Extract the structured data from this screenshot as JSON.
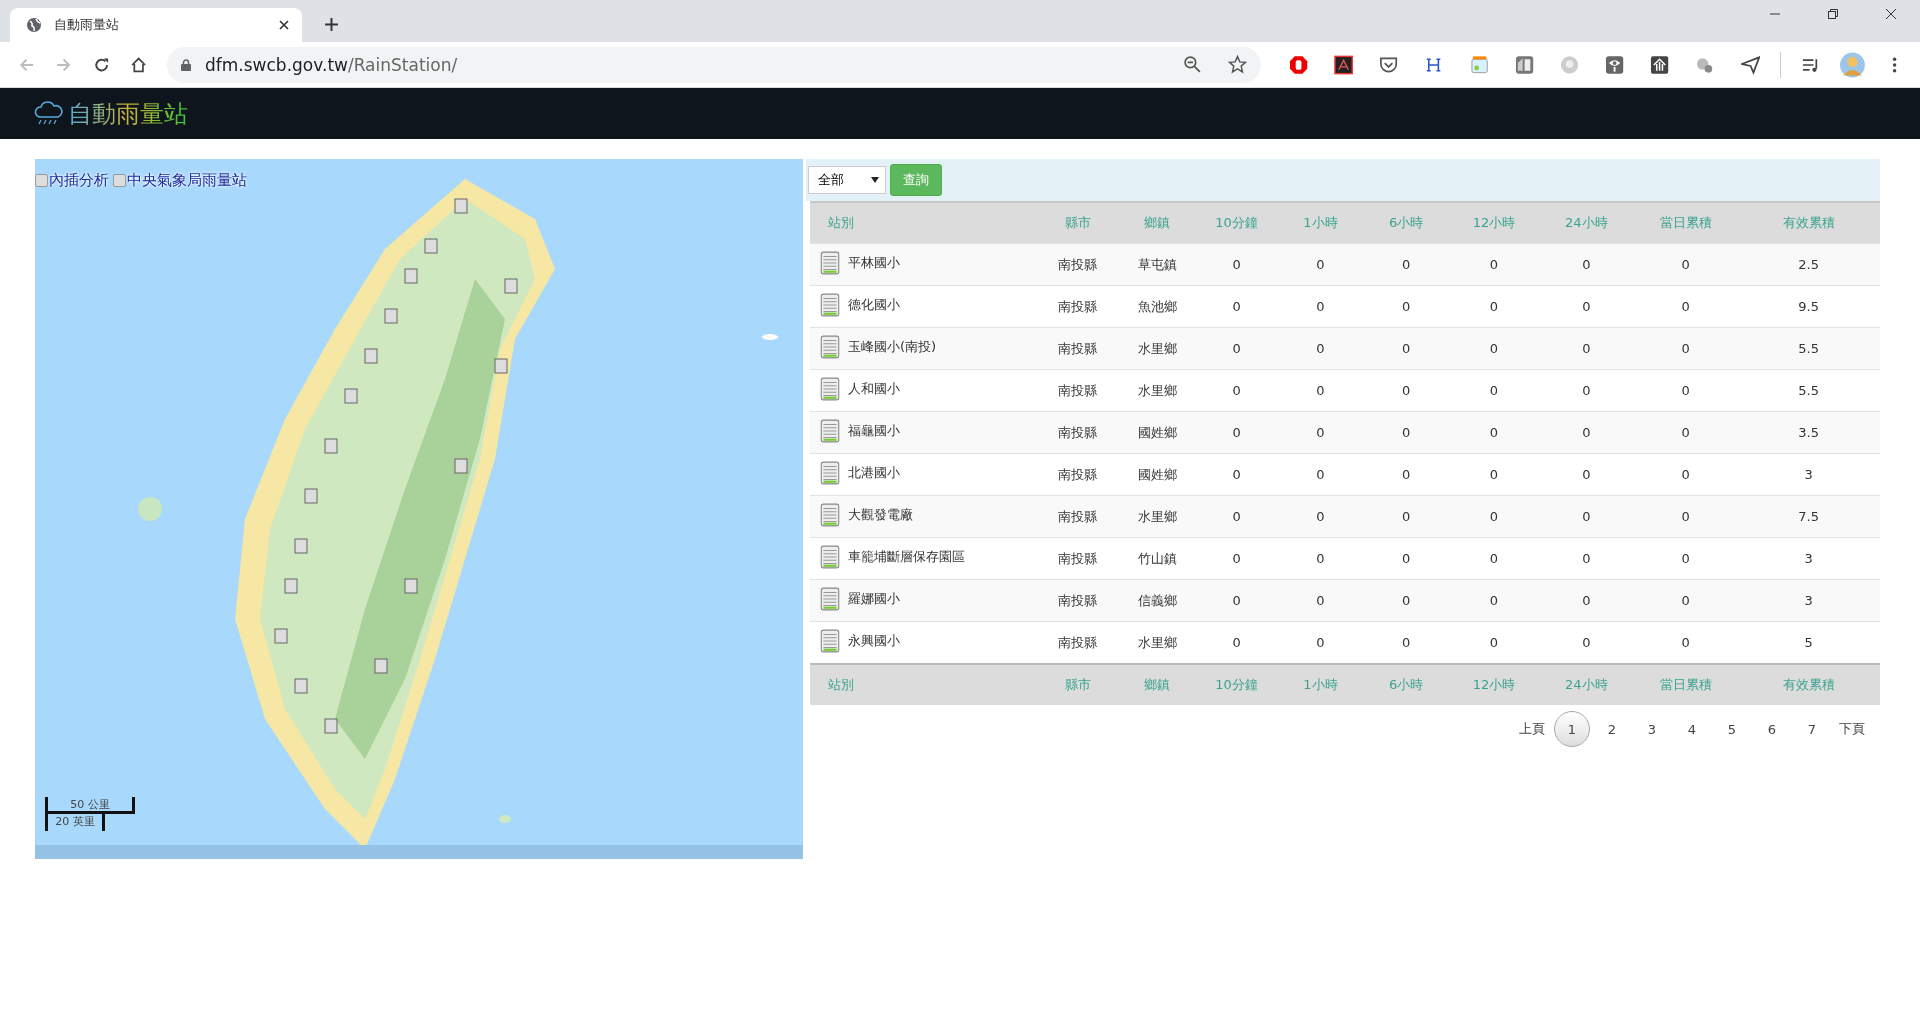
{
  "browser": {
    "tab_title": "自動雨量站",
    "url_host": "dfm.swcb.gov.tw",
    "url_path": "/RainStation/"
  },
  "header": {
    "title": "自動雨量站"
  },
  "map": {
    "layers": [
      {
        "label": "內插分析",
        "checked": false
      },
      {
        "label": "中央氣象局雨量站",
        "checked": false
      }
    ],
    "scale": [
      "50 公里",
      "20 英里"
    ]
  },
  "filter": {
    "select_value": "全部",
    "button": "查詢"
  },
  "table": {
    "columns": [
      "站別",
      "縣市",
      "鄉鎮",
      "10分鐘",
      "1小時",
      "6小時",
      "12小時",
      "24小時",
      "當日累積",
      "有效累積"
    ],
    "rows": [
      [
        "平林國小",
        "南投縣",
        "草屯鎮",
        "0",
        "0",
        "0",
        "0",
        "0",
        "0",
        "2.5"
      ],
      [
        "德化國小",
        "南投縣",
        "魚池鄉",
        "0",
        "0",
        "0",
        "0",
        "0",
        "0",
        "9.5"
      ],
      [
        "玉峰國小(南投)",
        "南投縣",
        "水里鄉",
        "0",
        "0",
        "0",
        "0",
        "0",
        "0",
        "5.5"
      ],
      [
        "人和國小",
        "南投縣",
        "水里鄉",
        "0",
        "0",
        "0",
        "0",
        "0",
        "0",
        "5.5"
      ],
      [
        "福龜國小",
        "南投縣",
        "國姓鄉",
        "0",
        "0",
        "0",
        "0",
        "0",
        "0",
        "3.5"
      ],
      [
        "北港國小",
        "南投縣",
        "國姓鄉",
        "0",
        "0",
        "0",
        "0",
        "0",
        "0",
        "3"
      ],
      [
        "大觀發電廠",
        "南投縣",
        "水里鄉",
        "0",
        "0",
        "0",
        "0",
        "0",
        "0",
        "7.5"
      ],
      [
        "車籠埔斷層保存園區",
        "南投縣",
        "竹山鎮",
        "0",
        "0",
        "0",
        "0",
        "0",
        "0",
        "3"
      ],
      [
        "羅娜國小",
        "南投縣",
        "信義鄉",
        "0",
        "0",
        "0",
        "0",
        "0",
        "0",
        "3"
      ],
      [
        "永興國小",
        "南投縣",
        "水里鄉",
        "0",
        "0",
        "0",
        "0",
        "0",
        "0",
        "5"
      ]
    ],
    "footer_columns": [
      "站別",
      "縣市",
      "鄉鎮",
      "10分鐘",
      "1小時",
      "6小時",
      "12小時",
      "24小時",
      "當日累積",
      "有效累積"
    ]
  },
  "pagination": {
    "prev": "上頁",
    "pages": [
      {
        "label": "1",
        "selected": true
      },
      {
        "label": "2",
        "selected": false
      },
      {
        "label": "3",
        "selected": false
      },
      {
        "label": "4",
        "selected": false
      },
      {
        "label": "5",
        "selected": false
      },
      {
        "label": "6",
        "selected": false
      },
      {
        "label": "7",
        "selected": false
      }
    ],
    "next": "下頁"
  }
}
